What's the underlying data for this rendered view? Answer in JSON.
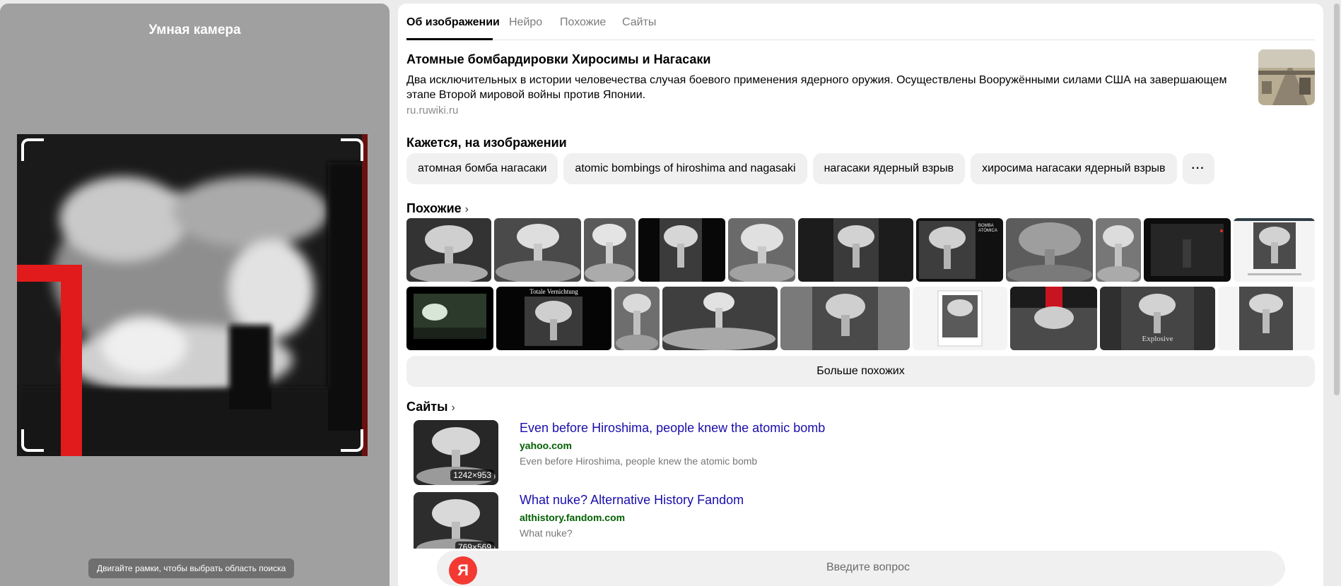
{
  "left_panel": {
    "title": "Умная камера",
    "hint": "Двигайте рамки, чтобы выбрать область поиска"
  },
  "tabs": [
    {
      "label": "Об изображении",
      "active": true
    },
    {
      "label": "Нейро",
      "active": false
    },
    {
      "label": "Похожие",
      "active": false
    },
    {
      "label": "Сайты",
      "active": false
    }
  ],
  "info": {
    "title": "Атомные бомбардировки Хиросимы и Нагасаки",
    "description": "Два исключительных в истории человечества случая боевого применения ядерного оружия. Осуществлены Вооружёнными силами США на завершающем этапе Второй мировой войны против Японии.",
    "source": "ru.ruwiki.ru"
  },
  "seems": {
    "heading": "Кажется, на изображении",
    "tags": [
      "атомная бомба нагасаки",
      "atomic bombings of hiroshima and nagasaki",
      "нагасаки ядерный взрыв",
      "хиросима нагасаки ядерный взрыв"
    ],
    "more": "···"
  },
  "similar": {
    "heading": "Похожие",
    "chevron": "›",
    "row1_thumb_text": [
      "BOMBA ATÓMICA"
    ],
    "row2_thumb_text": [
      "Totale Vernichtung",
      "Explosive"
    ],
    "more_button": "Больше похожих"
  },
  "sites": {
    "heading": "Сайты",
    "chevron": "›",
    "items": [
      {
        "title": "Even before Hiroshima, people knew the atomic bomb",
        "host": "yahoo.com",
        "snippet": "Even before Hiroshima, people knew the atomic bomb",
        "size": "1242×953"
      },
      {
        "title": "What nuke? Alternative History Fandom",
        "host": "althistory.fandom.com",
        "snippet": "What nuke?",
        "size": "769×569"
      }
    ]
  },
  "ask": {
    "logo": "Я",
    "placeholder": "Введите вопрос"
  },
  "colors": {
    "accent_red": "#f33a32",
    "link": "#1a0dab",
    "host_green": "#006000"
  }
}
